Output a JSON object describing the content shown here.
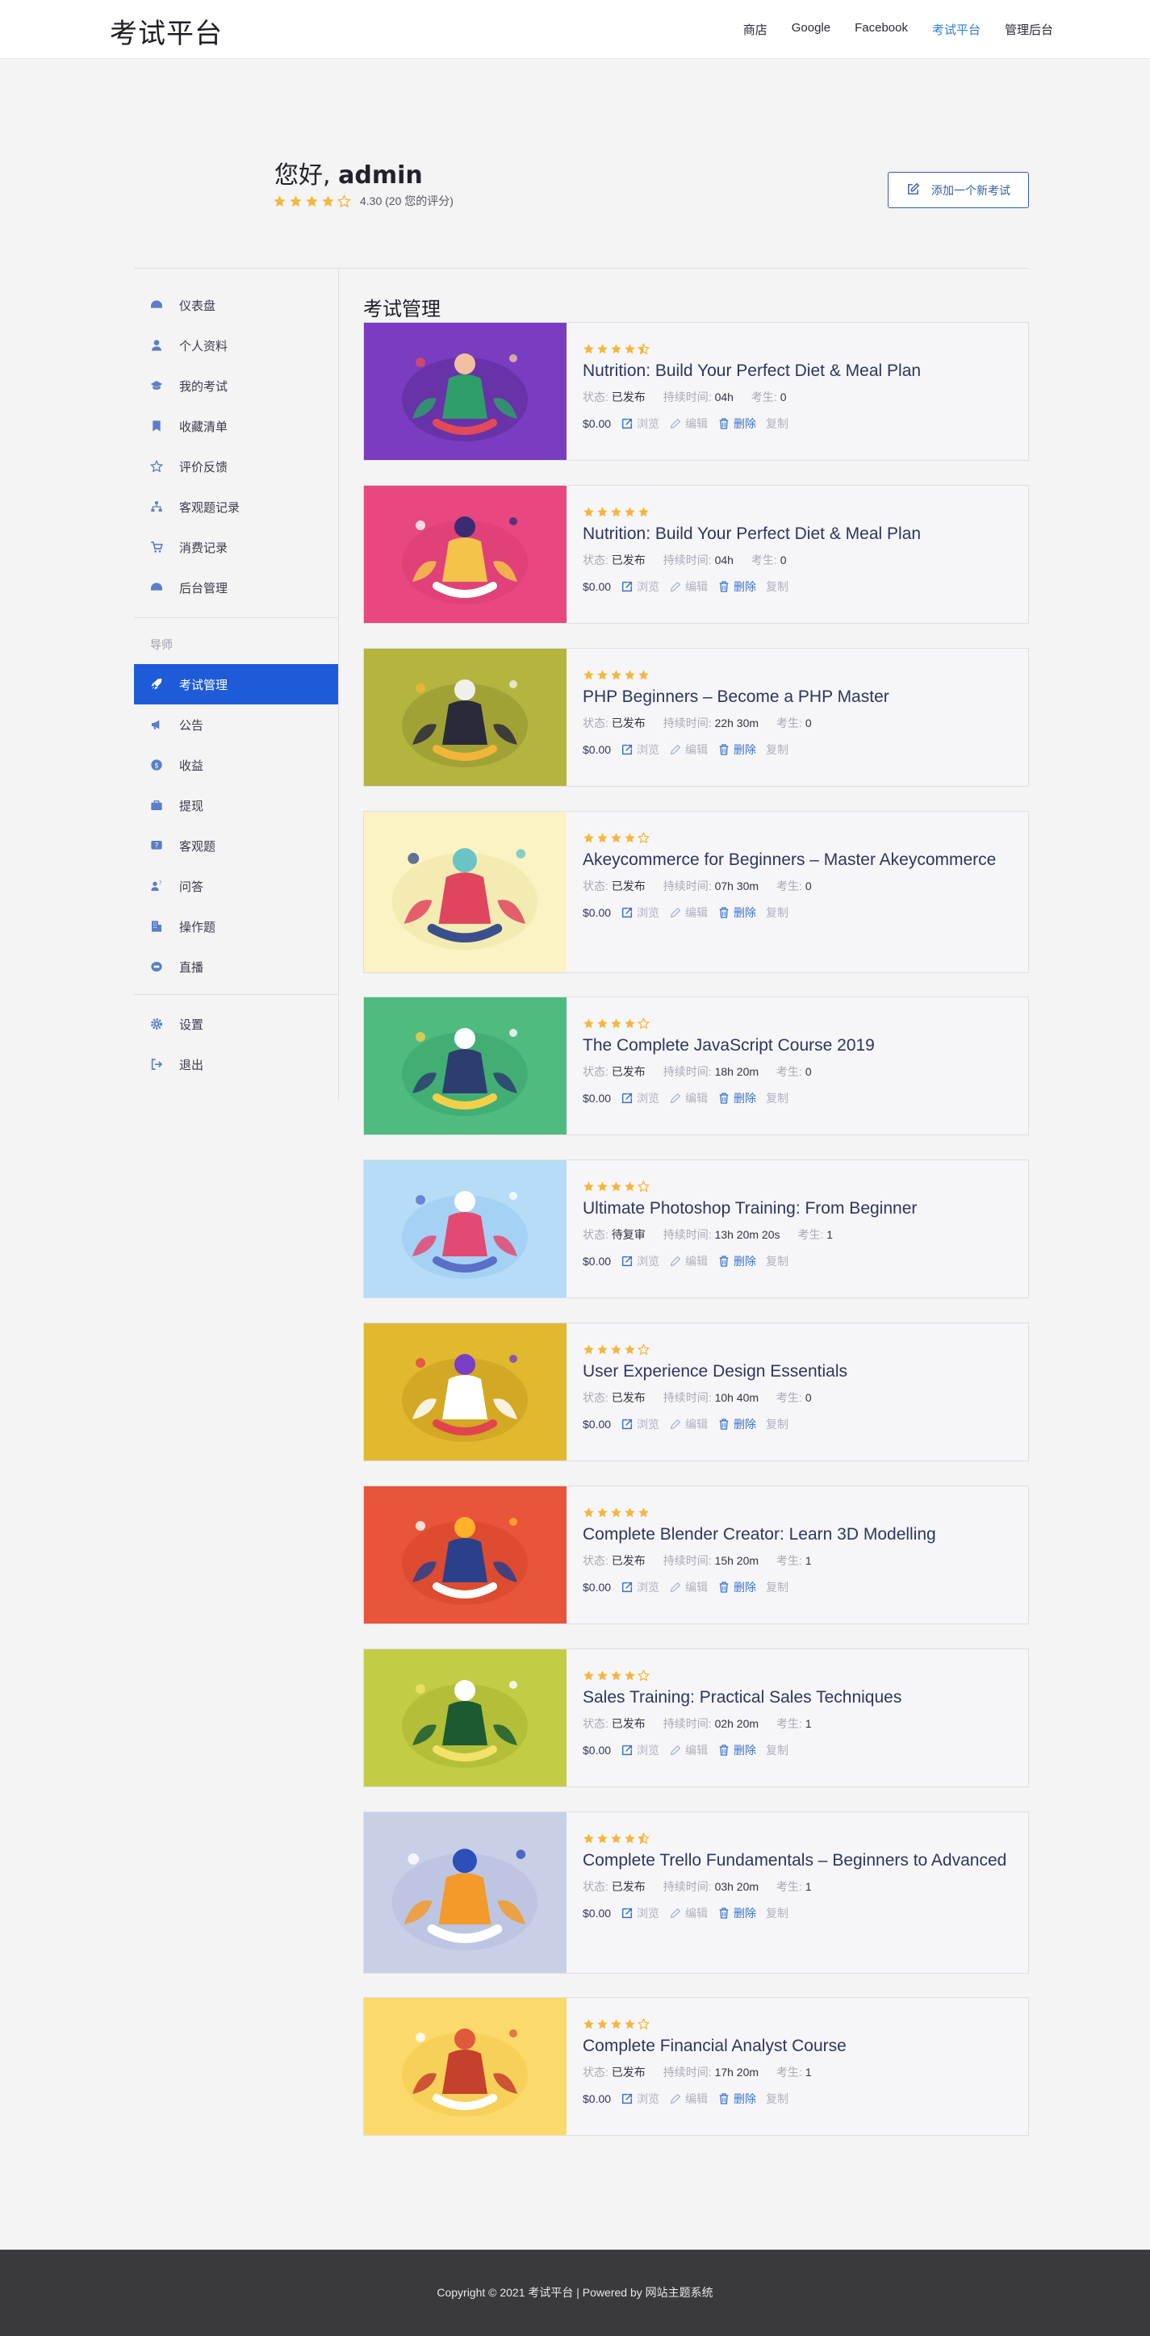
{
  "header": {
    "logo": "考试平台",
    "nav": [
      {
        "label": "商店",
        "active": false
      },
      {
        "label": "Google",
        "active": false
      },
      {
        "label": "Facebook",
        "active": false
      },
      {
        "label": "考试平台",
        "active": true
      },
      {
        "label": "管理后台",
        "active": false
      }
    ]
  },
  "profile": {
    "greeting": "您好,",
    "username": "admin",
    "rating_value": 4.3,
    "rating_text": "4.30 (20 您的评分)",
    "add_button": "添加一个新考试"
  },
  "sidebar": {
    "items": [
      {
        "label": "仪表盘",
        "icon": "dashboard-icon"
      },
      {
        "label": "个人资料",
        "icon": "user-icon"
      },
      {
        "label": "我的考试",
        "icon": "graduation-cap-icon"
      },
      {
        "label": "收藏清单",
        "icon": "bookmark-icon"
      },
      {
        "label": "评价反馈",
        "icon": "star-review-icon"
      },
      {
        "label": "客观题记录",
        "icon": "sitemap-icon"
      },
      {
        "label": "消费记录",
        "icon": "cart-icon"
      },
      {
        "label": "后台管理",
        "icon": "dashboard-icon"
      }
    ],
    "section_heading": "导师",
    "instructor_items": [
      {
        "label": "考试管理",
        "icon": "rocket-icon",
        "active": true
      },
      {
        "label": "公告",
        "icon": "megaphone-icon"
      },
      {
        "label": "收益",
        "icon": "dollar-icon"
      },
      {
        "label": "提现",
        "icon": "briefcase-icon"
      },
      {
        "label": "客观题",
        "icon": "question-icon"
      },
      {
        "label": "问答",
        "icon": "qa-icon"
      },
      {
        "label": "操作题",
        "icon": "building-icon"
      },
      {
        "label": "直播",
        "icon": "live-icon"
      }
    ],
    "bottom_items": [
      {
        "label": "设置",
        "icon": "gear-icon"
      },
      {
        "label": "退出",
        "icon": "sign-out-icon"
      }
    ]
  },
  "main": {
    "section_title": "考试管理",
    "labels": {
      "status": "状态:",
      "duration": "持续时间:",
      "students": "考生:",
      "view": "浏览",
      "edit": "编辑",
      "delete": "删除",
      "duplicate": "复制"
    },
    "courses": [
      {
        "title": "Nutrition: Build Your Perfect Diet & Meal Plan",
        "rating": 4.5,
        "status": "已发布",
        "duration": "04h",
        "students": "0",
        "price": "$0.00",
        "thumb_color": "#7a3cc0"
      },
      {
        "title": "Nutrition: Build Your Perfect Diet & Meal Plan",
        "rating": 5,
        "status": "已发布",
        "duration": "04h",
        "students": "0",
        "price": "$0.00",
        "thumb_color": "#e8477f"
      },
      {
        "title": "PHP Beginners – Become a PHP Master",
        "rating": 5,
        "status": "已发布",
        "duration": "22h 30m",
        "students": "0",
        "price": "$0.00",
        "thumb_color": "#b3b53f"
      },
      {
        "title": "Akeycommerce for Beginners – Master Akeycommerce",
        "rating": 4,
        "status": "已发布",
        "duration": "07h 30m",
        "students": "0",
        "price": "$0.00",
        "thumb_color": "#fbf3c3"
      },
      {
        "title": "The Complete JavaScript Course 2019",
        "rating": 4,
        "status": "已发布",
        "duration": "18h 20m",
        "students": "0",
        "price": "$0.00",
        "thumb_color": "#4fbb7f"
      },
      {
        "title": "Ultimate Photoshop Training: From Beginner",
        "rating": 4,
        "status": "待复审",
        "duration": "13h 20m 20s",
        "students": "1",
        "price": "$0.00",
        "thumb_color": "#b6dcf8"
      },
      {
        "title": "User Experience Design Essentials",
        "rating": 4,
        "status": "已发布",
        "duration": "10h 40m",
        "students": "0",
        "price": "$0.00",
        "thumb_color": "#e0b92e"
      },
      {
        "title": "Complete Blender Creator: Learn 3D Modelling",
        "rating": 5,
        "status": "已发布",
        "duration": "15h 20m",
        "students": "1",
        "price": "$0.00",
        "thumb_color": "#e8553a"
      },
      {
        "title": "Sales Training: Practical Sales Techniques",
        "rating": 4,
        "status": "已发布",
        "duration": "02h 20m",
        "students": "1",
        "price": "$0.00",
        "thumb_color": "#c2cd45"
      },
      {
        "title": "Complete Trello Fundamentals – Beginners to Advanced",
        "rating": 4.5,
        "status": "已发布",
        "duration": "03h 20m",
        "students": "1",
        "price": "$0.00",
        "thumb_color": "#c8d0e8"
      },
      {
        "title": "Complete Financial Analyst Course",
        "rating": 4,
        "status": "已发布",
        "duration": "17h 20m",
        "students": "1",
        "price": "$0.00",
        "thumb_color": "#fbd96a"
      }
    ]
  },
  "footer": {
    "text": "Copyright © 2021 考试平台 | Powered by 网站主题系统"
  },
  "colors": {
    "accent": "#1e5bd8",
    "link_active": "#2f7ed8",
    "star": "#f4b63f",
    "footer_bg": "#3a3a3c"
  }
}
